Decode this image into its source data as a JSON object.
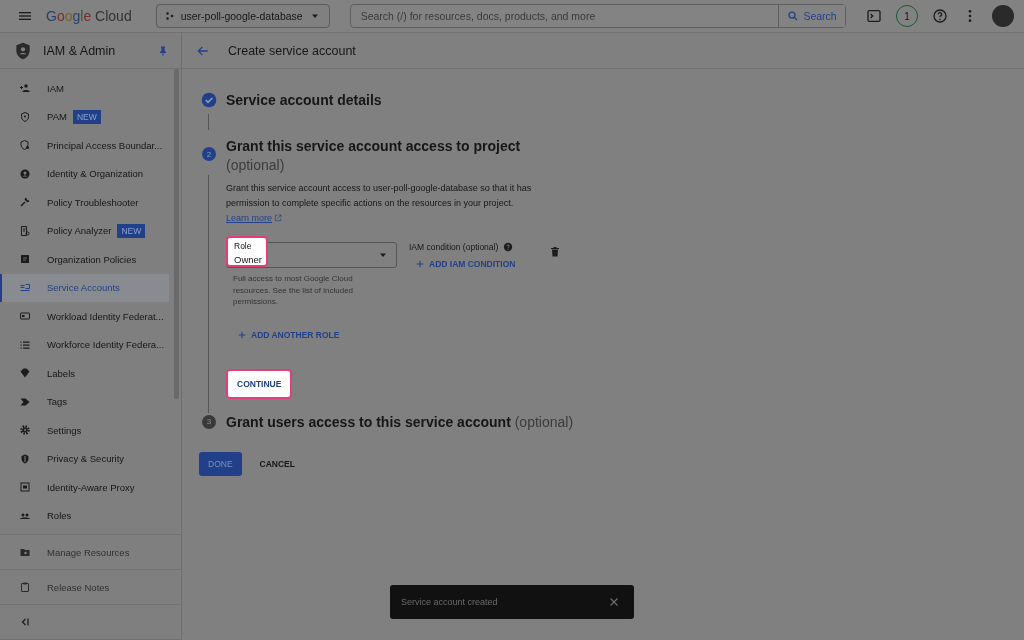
{
  "topbar": {
    "logo": {
      "brand": "Google",
      "product": "Cloud"
    },
    "project": "user-poll-google-database",
    "search": {
      "placeholder": "Search (/) for resources, docs, products, and more",
      "button": "Search"
    },
    "notifications": "1"
  },
  "sidebar": {
    "title": "IAM & Admin",
    "pinned": true,
    "items": [
      {
        "label": "IAM",
        "selected": false
      },
      {
        "label": "PAM",
        "badge": "NEW",
        "selected": false
      },
      {
        "label": "Principal Access Boundar...",
        "selected": false
      },
      {
        "label": "Identity & Organization",
        "selected": false
      },
      {
        "label": "Policy Troubleshooter",
        "selected": false
      },
      {
        "label": "Policy Analyzer",
        "badge": "NEW",
        "selected": false
      },
      {
        "label": "Organization Policies",
        "selected": false
      },
      {
        "label": "Service Accounts",
        "selected": true
      },
      {
        "label": "Workload Identity Federat...",
        "selected": false
      },
      {
        "label": "Workforce Identity Federa...",
        "selected": false
      },
      {
        "label": "Labels",
        "selected": false
      },
      {
        "label": "Tags",
        "selected": false
      },
      {
        "label": "Settings",
        "selected": false
      },
      {
        "label": "Privacy & Security",
        "selected": false
      },
      {
        "label": "Identity-Aware Proxy",
        "selected": false
      },
      {
        "label": "Roles",
        "selected": false
      }
    ],
    "footer_items": [
      {
        "label": "Manage Resources"
      },
      {
        "label": "Release Notes"
      }
    ]
  },
  "page": {
    "title": "Create service account"
  },
  "steps": [
    {
      "completed": true,
      "active": false,
      "title": "Service account details"
    },
    {
      "completed": false,
      "active": true,
      "number": "2",
      "title": "Grant this service account access to project",
      "optional": "(optional)"
    },
    {
      "completed": false,
      "active": false,
      "number": "3",
      "title": "Grant users access to this service account",
      "optional": "(optional)"
    }
  ],
  "grant": {
    "description": "Grant this service account access to user-poll-google-database so that it has permission to complete specific actions on the resources in your project.",
    "link": "Learn more",
    "role_field": {
      "label": "Role",
      "value": "Owner",
      "highlighted": true,
      "helper": "Full access to most Google Cloud resources. See the list of included permissions."
    },
    "condition": {
      "label": "IAM condition (optional)",
      "action": "ADD IAM CONDITION"
    },
    "add_role": "ADD ANOTHER ROLE",
    "continue": {
      "label": "CONTINUE",
      "highlighted": true
    }
  },
  "actions": [
    {
      "label": "DONE",
      "kind": "primary"
    },
    {
      "label": "CANCEL",
      "kind": "text"
    }
  ],
  "snackbar": {
    "message": "Service account created"
  }
}
